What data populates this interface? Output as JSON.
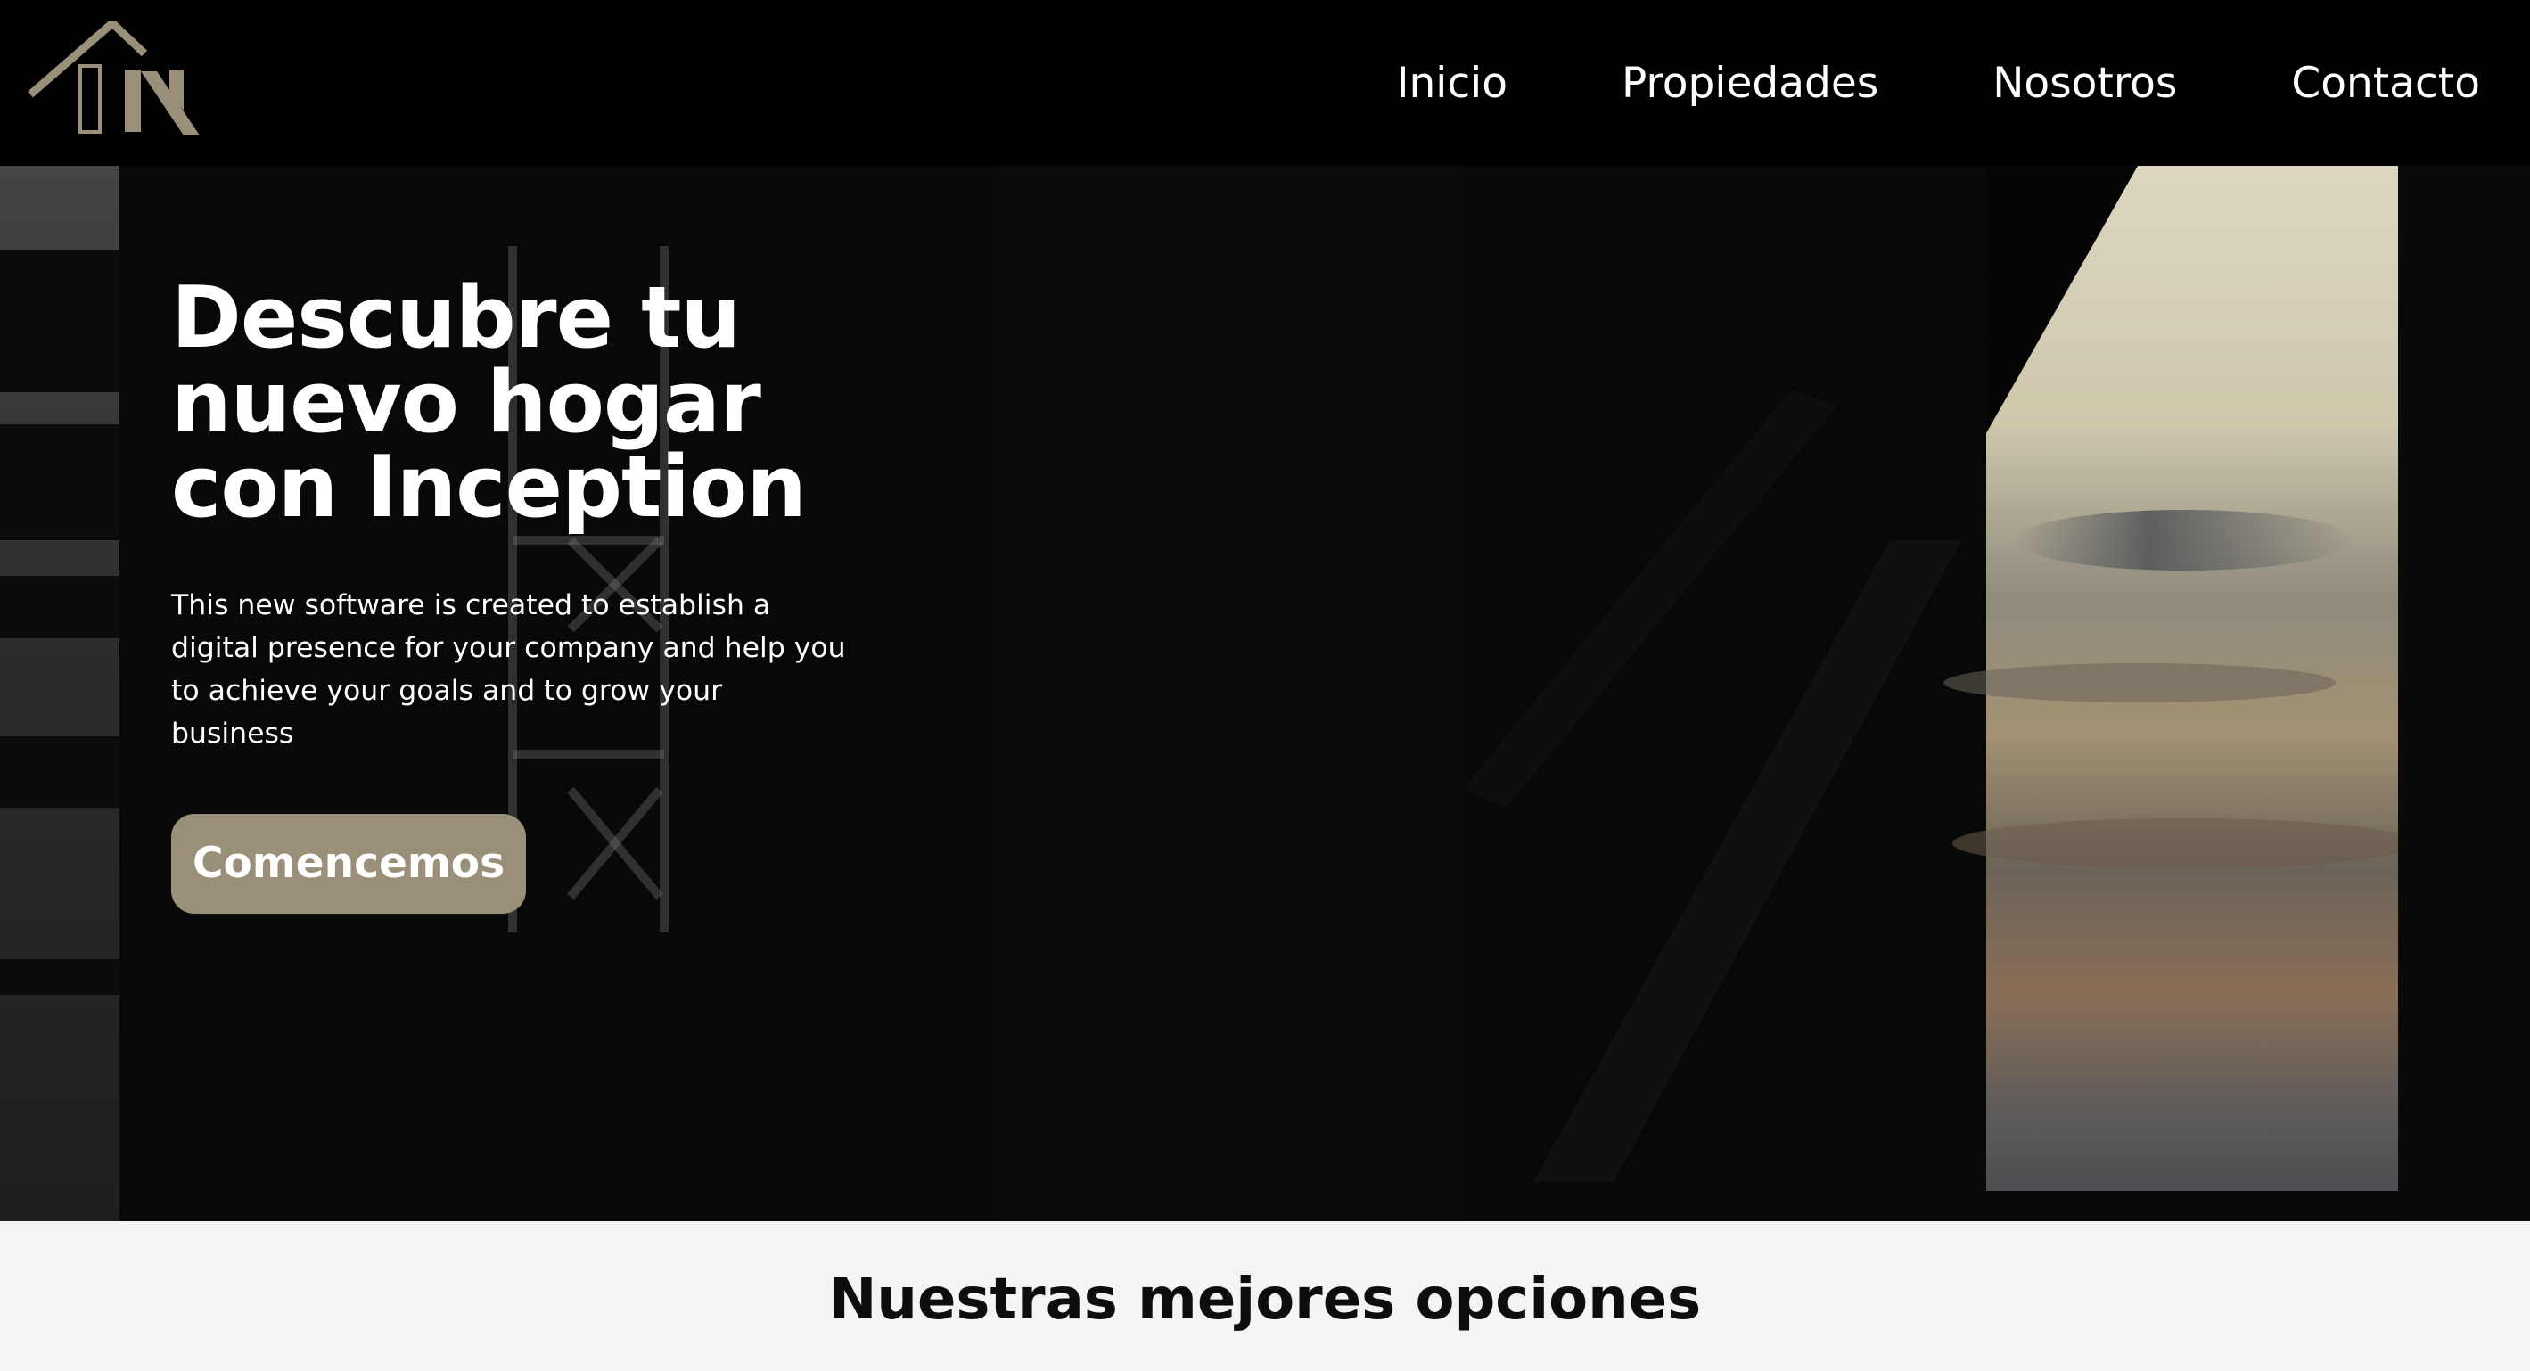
{
  "header": {
    "logo_icon": "house-n-logo-icon",
    "nav": [
      {
        "label": "Inicio"
      },
      {
        "label": "Propiedades"
      },
      {
        "label": "Nosotros"
      },
      {
        "label": "Contacto"
      }
    ]
  },
  "hero": {
    "title": "Descubre tu nuevo hogar con Inception",
    "description": "This new software is created to establish a digital presence for your company and help you to achieve your goals and to grow your business",
    "cta_label": "Comencemos"
  },
  "options": {
    "title": "Nuestras mejores opciones"
  },
  "colors": {
    "accent": "#9a8f78",
    "header_bg": "#000000",
    "section_bg": "#f4f4f4"
  }
}
